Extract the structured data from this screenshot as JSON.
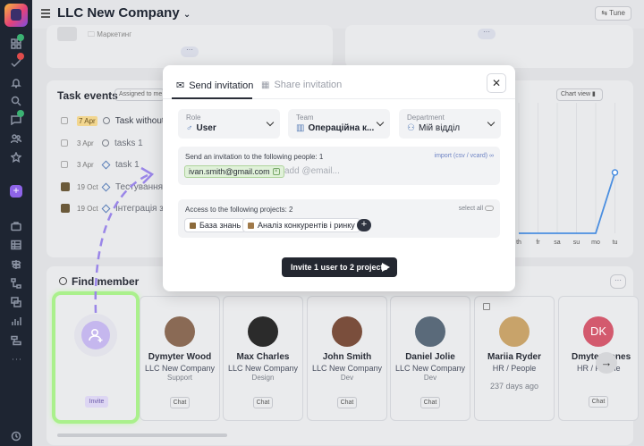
{
  "header": {
    "company_name": "LLC New Company",
    "tune_label": "Tune"
  },
  "background": {
    "marketing_label": "Маркетинг",
    "task_events_title": "Task events",
    "assigned_label": "Assigned to me",
    "chart_view_label": "Chart view",
    "tasks": [
      {
        "date": "7 Apr",
        "title": "Task without a"
      },
      {
        "date": "3 Apr",
        "title": "tasks 1"
      },
      {
        "date": "3 Apr",
        "title": "task 1"
      },
      {
        "date": "19 Oct",
        "title": "Тестування ф"
      },
      {
        "date": "19 Oct",
        "title": "Інтеграція з С"
      }
    ],
    "days": [
      "th",
      "fr",
      "sa",
      "su",
      "mo",
      "tu"
    ],
    "chart_data": {
      "type": "line",
      "categories": [
        "th",
        "fr",
        "sa",
        "su",
        "mo",
        "tu"
      ],
      "values": [
        0,
        0,
        0,
        0,
        0,
        1
      ]
    }
  },
  "find_member": {
    "title": "Find member",
    "invite_label": "Invite",
    "chat_label": "Chat",
    "members": [
      {
        "name": "Dymyter Wood",
        "company": "LLC New Company",
        "role": "Support",
        "photo": "#8a6a55"
      },
      {
        "name": "Max Charles",
        "company": "LLC New Company",
        "role": "Design",
        "photo": "#2b2b2b"
      },
      {
        "name": "John Smith",
        "company": "LLC New Company",
        "role": "Dev",
        "photo": "#7a4e3c"
      },
      {
        "name": "Daniel Jolie",
        "company": "LLC New Company",
        "role": "Dev",
        "photo": "#5a6a7a"
      },
      {
        "name": "Mariia Ryder",
        "company": "HR / People",
        "role": "237 days ago",
        "photo": "#c8a36a"
      },
      {
        "name": "Dmyter Jones",
        "company": "HR / People",
        "role": "",
        "initials": "DK"
      }
    ]
  },
  "modal": {
    "tab_send": "Send invitation",
    "tab_share": "Share invitation",
    "role_label": "Role",
    "role_value": "User",
    "team_label": "Team",
    "team_value": "Операційна к...",
    "department_label": "Department",
    "department_value": "Мій відділ",
    "invite_heading": "Send an invitation to the following people:  1",
    "import_label": "import (csv / vcard)",
    "email_chip": "ivan.smith@gmail.com",
    "email_placeholder": "add @email...",
    "projects_heading": "Access to the following projects:  2",
    "select_all_label": "select all",
    "projects": [
      "База знань",
      "Аналіз конкурентів і ринку"
    ],
    "primary_label": "Invite 1 user to 2 projects"
  },
  "colors": {
    "accent_purple": "#8e64e8",
    "highlight_green": "#aaf08c",
    "chart_blue": "#4a8ee0",
    "primary_dark": "#232730"
  }
}
